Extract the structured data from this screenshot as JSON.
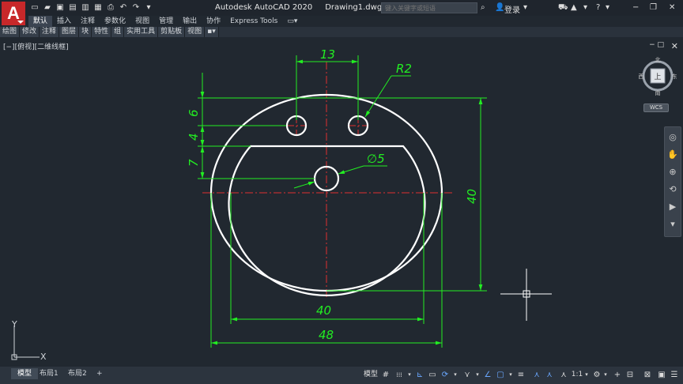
{
  "app": {
    "logo": "A",
    "title": "Autodesk AutoCAD 2020",
    "filename": "Drawing1.dwg",
    "search_placeholder": "键入关键字或短语",
    "login": "登录"
  },
  "qat": [
    "new-icon",
    "open-icon",
    "save-icon",
    "saveas-icon",
    "web-open-icon",
    "web-save-icon",
    "plot-icon",
    "undo-icon",
    "redo-icon",
    "qat-dropdown-icon"
  ],
  "ribbon_tabs": [
    "默认",
    "插入",
    "注释",
    "参数化",
    "视图",
    "管理",
    "输出",
    "协作",
    "Express Tools"
  ],
  "ribbon_active": "默认",
  "panels": [
    "绘图",
    "修改",
    "注释",
    "图层",
    "块",
    "特性",
    "组",
    "实用工具",
    "剪贴板",
    "视图"
  ],
  "viewport": {
    "label": "[−][俯视][二维线框]",
    "minmax": "− □",
    "close": "✕"
  },
  "drawing": {
    "colors": {
      "geometry": "#ffffff",
      "dimension": "#22ee22",
      "center": "#e03030",
      "crosshair": "#ffffff"
    },
    "dims": {
      "top_width": "13",
      "radius": "R2",
      "hole_d": "∅5",
      "v1": "6",
      "v2": "4",
      "v3": "7",
      "height": "40",
      "inner_width": "40",
      "outer_width": "48"
    }
  },
  "viewcube": {
    "north": "北",
    "south": "南",
    "east": "东",
    "west": "西",
    "face": "上",
    "wcs": "WCS"
  },
  "ucs": {
    "x": "X",
    "y": "Y"
  },
  "layout_tabs": [
    "模型",
    "布局1",
    "布局2",
    "+"
  ],
  "status": {
    "model": "模型",
    "grid": "#",
    "snap": "⁞⁞⁞",
    "scale": "1:1"
  }
}
